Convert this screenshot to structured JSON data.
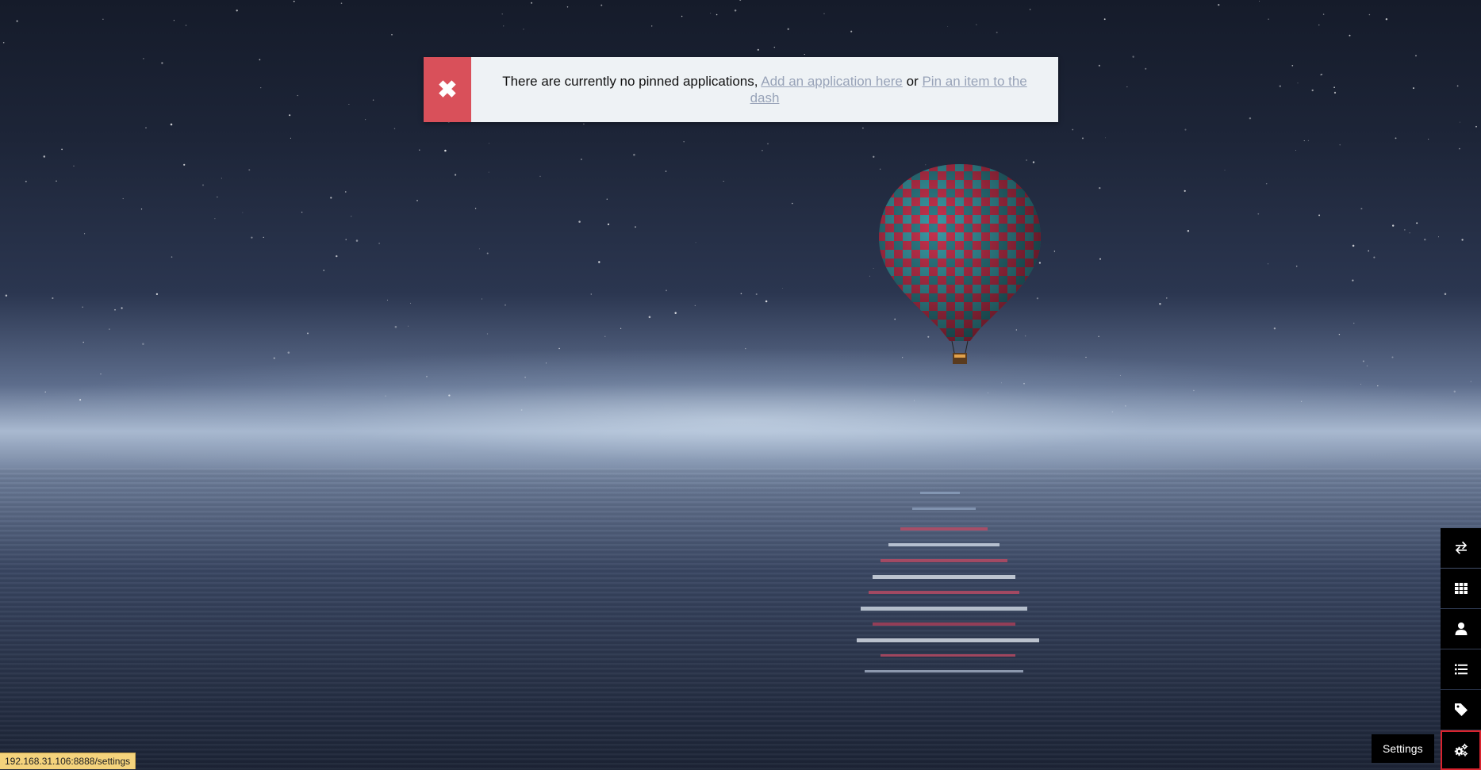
{
  "notification": {
    "text_before": "There are currently no pinned applications, ",
    "link_add": "Add an application here",
    "text_middle": " or ",
    "link_pin": "Pin an item to the dash",
    "icon": "close-icon",
    "accent_color": "#d9505a"
  },
  "dock": {
    "items": [
      {
        "name": "swap-icon",
        "active": false
      },
      {
        "name": "grid-icon",
        "active": false
      },
      {
        "name": "user-icon",
        "active": false
      },
      {
        "name": "list-icon",
        "active": false
      },
      {
        "name": "tag-icon",
        "active": false
      },
      {
        "name": "cogs-icon",
        "active": true
      }
    ],
    "active_border_color": "#d9232e"
  },
  "tooltip": {
    "label": "Settings"
  },
  "status_url": "192.168.31.106:8888/settings"
}
